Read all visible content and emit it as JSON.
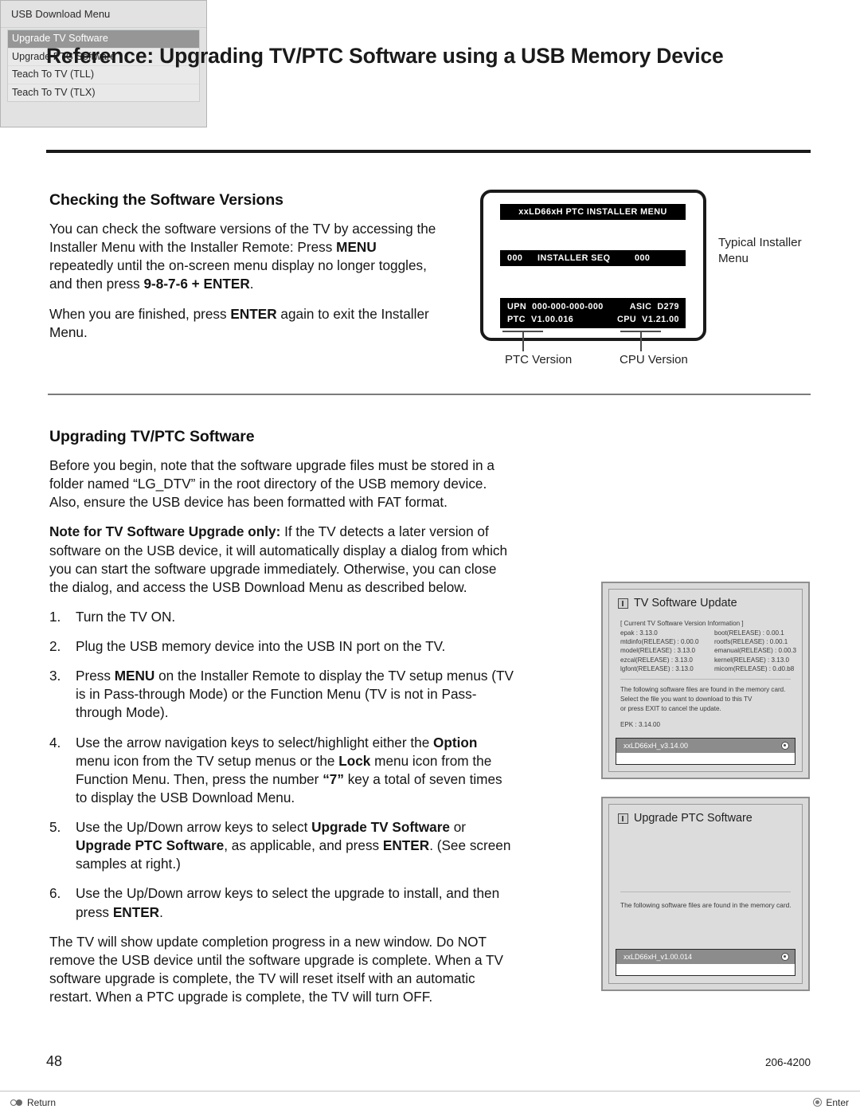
{
  "page": {
    "title": "Reference: Upgrading TV/PTC Software using a USB Memory Device",
    "footer_page_number": "48",
    "footer_doc_code": "206-4200"
  },
  "section_versions": {
    "heading": "Checking the Software Versions",
    "para1_a": "You can check the software versions of the TV by accessing the Installer Menu with the Installer Remote: Press ",
    "para1_b": "MENU",
    "para1_c": " repeatedly until the on-screen menu display no longer toggles, and then press ",
    "para1_d": "9-8-7-6 + ENTER",
    "para1_e": ".",
    "para2_a": "When you are finished, press ",
    "para2_b": "ENTER",
    "para2_c": " again to exit the Installer Menu."
  },
  "installer_menu": {
    "title_bar": "xxLD66xH  PTC  INSTALLER  MENU",
    "seq_left": "000",
    "seq_label": "INSTALLER SEQ",
    "seq_right": "000",
    "upn_label": "UPN",
    "upn_value": "000-000-000-000",
    "asic_label": "ASIC",
    "asic_value": "D279",
    "ptc_label": "PTC",
    "ptc_value": "V1.00.016",
    "cpu_label": "CPU",
    "cpu_value": "V1.21.00",
    "caption_ptc": "PTC Version",
    "caption_cpu": "CPU Version",
    "caption_typical": "Typical Installer Menu"
  },
  "section_upgrading": {
    "heading": "Upgrading TV/PTC Software",
    "para1": "Before you begin, note that the software upgrade files must be stored in a folder named “LG_DTV” in the root directory of the USB memory device. Also, ensure the USB device has been formatted with FAT format.",
    "note_bold": "Note for TV Software Upgrade only:",
    "note_rest": " If the TV detects a later version of software on the USB device, it will automatically display a dialog from which you can start the software upgrade immediately. Otherwise, you can close the dialog, and access the USB Download Menu as described below.",
    "steps": [
      {
        "num": "1.",
        "text": "Turn the TV ON."
      },
      {
        "num": "2.",
        "text": "Plug the USB memory device into the USB IN port on the TV."
      },
      {
        "num": "3.",
        "text": "Press MENU on the Installer Remote to display the TV setup menus (TV is in Pass-through Mode) or the Function Menu (TV is not in Pass-through Mode)."
      },
      {
        "num": "4.",
        "text": "Use the arrow navigation keys to select/highlight either the Option menu icon from the TV setup menus or the Lock menu icon from the Function Menu. Then, press the number “7” key a total of seven times to display the USB Download Menu."
      },
      {
        "num": "5.",
        "text": "Use the Up/Down arrow keys to select Upgrade TV Software or Upgrade PTC Software, as applicable, and press ENTER. (See screen samples at right.)"
      },
      {
        "num": "6.",
        "text": "Use the Up/Down arrow keys to select the upgrade to install, and then press ENTER."
      }
    ],
    "closing_para": "The TV will show update completion progress in a new window. Do NOT remove the USB device until the software upgrade is complete. When a TV software upgrade is complete, the TV will reset itself with an automatic restart. When a PTC upgrade is complete, the TV will turn OFF."
  },
  "usb_download_menu": {
    "title": "USB Download Menu",
    "items": [
      {
        "label": "Upgrade TV Software",
        "selected": true
      },
      {
        "label": "Upgrade PTC Software",
        "selected": false
      },
      {
        "label": "Teach To TV (TLL)",
        "selected": false
      },
      {
        "label": "Teach To TV (TLX)",
        "selected": false
      }
    ],
    "footer_return": "Return",
    "footer_enter": "Enter"
  },
  "tv_software_update": {
    "title": "TV Software Update",
    "version_header": "[ Current TV Software Version Information ]",
    "versions_left": [
      "epak : 3.13.0",
      "mtdinfo(RELEASE) : 0.00.0",
      "model(RELEASE) : 3.13.0",
      "ezcal(RELEASE) : 3.13.0",
      "lgfont(RELEASE) : 3.13.0"
    ],
    "versions_right": [
      "boot(RELEASE) : 0.00.1",
      "rootfs(RELEASE) : 0.00.1",
      "emanual(RELEASE) : 0.00.3",
      "kernel(RELEASE) : 3.13.0",
      "micom(RELEASE) : 0.d0.b8"
    ],
    "note_line1": "The following software files are found in the memory card.",
    "note_line2": "Select the file you want to download to this TV",
    "note_line3": "or press EXIT to cancel the update.",
    "epk": "EPK : 3.14.00",
    "file_name": "xxLD66xH_v3.14.00"
  },
  "ptc_software_update": {
    "title": "Upgrade PTC Software",
    "note_line1": "The following software files are found in the memory card.",
    "file_name": "xxLD66xH_v1.00.014"
  },
  "colors": {
    "rule_dark": "#1a1a1a",
    "rule_light": "#7b7b7b",
    "osd_bar_bg": "#000000",
    "osd_bar_fg": "#ffffff",
    "menu_selected_bg": "#969696",
    "dialog_bg": "#dcdcdc"
  }
}
